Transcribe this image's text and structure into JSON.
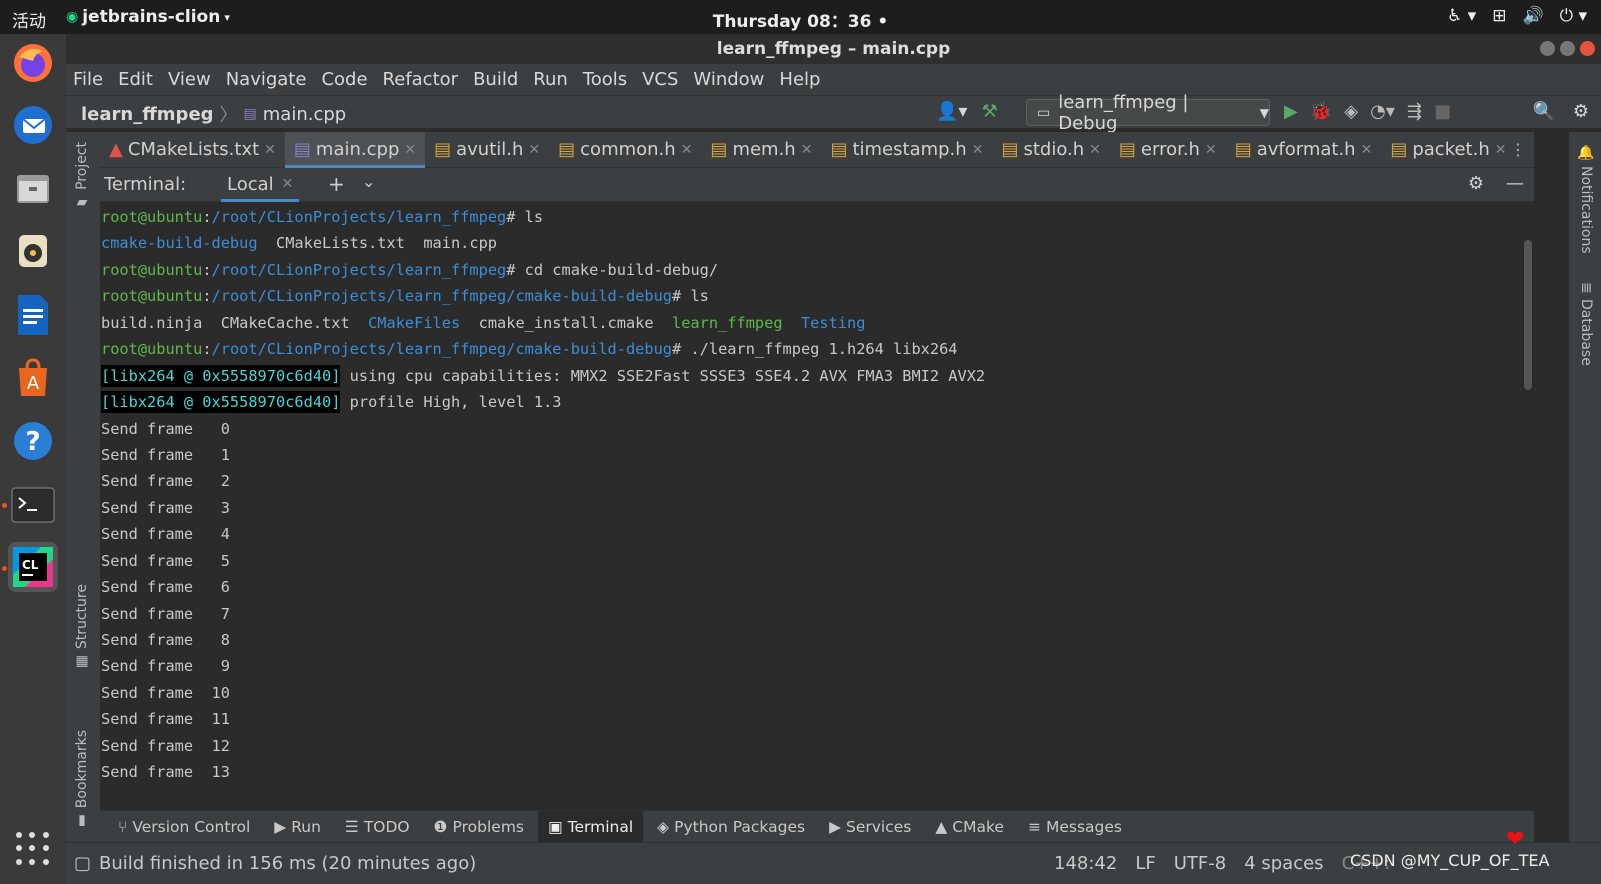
{
  "topbar": {
    "activities": "活动",
    "app": "jetbrains-clion",
    "clock": "Thursday 08：36",
    "tray_icons": [
      "accessibility-icon",
      "network-icon",
      "volume-icon",
      "power-icon"
    ]
  },
  "dock": {
    "apps": [
      "firefox",
      "thunderbird",
      "files",
      "rhythmbox",
      "libreoffice-writer",
      "ubuntu-software",
      "help",
      "terminal",
      "clion"
    ]
  },
  "window": {
    "title": "learn_ffmpeg – main.cpp"
  },
  "menu": [
    "File",
    "Edit",
    "View",
    "Navigate",
    "Code",
    "Refactor",
    "Build",
    "Run",
    "Tools",
    "VCS",
    "Window",
    "Help"
  ],
  "nav": {
    "project": "learn_ffmpeg",
    "file": "main.cpp",
    "run_config": "learn_ffmpeg | Debug"
  },
  "tabs": [
    {
      "label": "CMakeLists.txt",
      "icon": "cmake-icon"
    },
    {
      "label": "main.cpp",
      "icon": "cpp-file-icon",
      "active": true
    },
    {
      "label": "avutil.h",
      "icon": "header-file-icon"
    },
    {
      "label": "common.h",
      "icon": "header-file-icon"
    },
    {
      "label": "mem.h",
      "icon": "header-file-icon"
    },
    {
      "label": "timestamp.h",
      "icon": "header-file-icon"
    },
    {
      "label": "stdio.h",
      "icon": "header-file-icon"
    },
    {
      "label": "error.h",
      "icon": "header-file-icon"
    },
    {
      "label": "avformat.h",
      "icon": "header-file-icon"
    },
    {
      "label": "packet.h",
      "icon": "header-file-icon"
    }
  ],
  "side": {
    "left": [
      "Project",
      "Structure",
      "Bookmarks"
    ],
    "right": [
      "Notifications",
      "Database"
    ]
  },
  "terminal": {
    "title": "Terminal:",
    "tab": "Local",
    "prompt_user": "root@ubuntu",
    "path1": "/root/CLionProjects/learn_ffmpeg",
    "path2": "/root/CLionProjects/learn_ffmpeg/cmake-build-debug",
    "cmd_ls": "ls",
    "cmd_cd": "cd cmake-build-debug/",
    "cmd_run": "./learn_ffmpeg 1.h264 libx264",
    "ls1": {
      "dir": "cmake-build-debug",
      "rest": "  CMakeLists.txt  main.cpp"
    },
    "ls2": {
      "f1": "build.ninja  CMakeCache.txt  ",
      "d1": "CMakeFiles",
      "f2": "  cmake_install.cmake  ",
      "exe": "learn_ffmpeg",
      "d2": "Testing"
    },
    "libx_tag": "[libx264 @ 0x5558970c6d40]",
    "libx_msg1": "using cpu capabilities: MMX2 SSE2Fast SSSE3 SSE4.2 AVX FMA3 BMI2 AVX2",
    "libx_msg2": "profile High, level 1.3",
    "frames": [
      "Send frame   0",
      "Send frame   1",
      "Send frame   2",
      "Send frame   3",
      "Send frame   4",
      "Send frame   5",
      "Send frame   6",
      "Send frame   7",
      "Send frame   8",
      "Send frame   9",
      "Send frame  10",
      "Send frame  11",
      "Send frame  12",
      "Send frame  13"
    ]
  },
  "toolwindows": [
    "Version Control",
    "Run",
    "TODO",
    "Problems",
    "Terminal",
    "Python Packages",
    "Services",
    "CMake",
    "Messages"
  ],
  "status": {
    "message": "Build finished in 156 ms (20 minutes ago)",
    "position": "148:42",
    "line_sep": "LF",
    "encoding": "UTF-8",
    "indent": "4 spaces",
    "lang": "C++:",
    "watermark": "CSDN @MY_CUP_OF_TEA"
  }
}
